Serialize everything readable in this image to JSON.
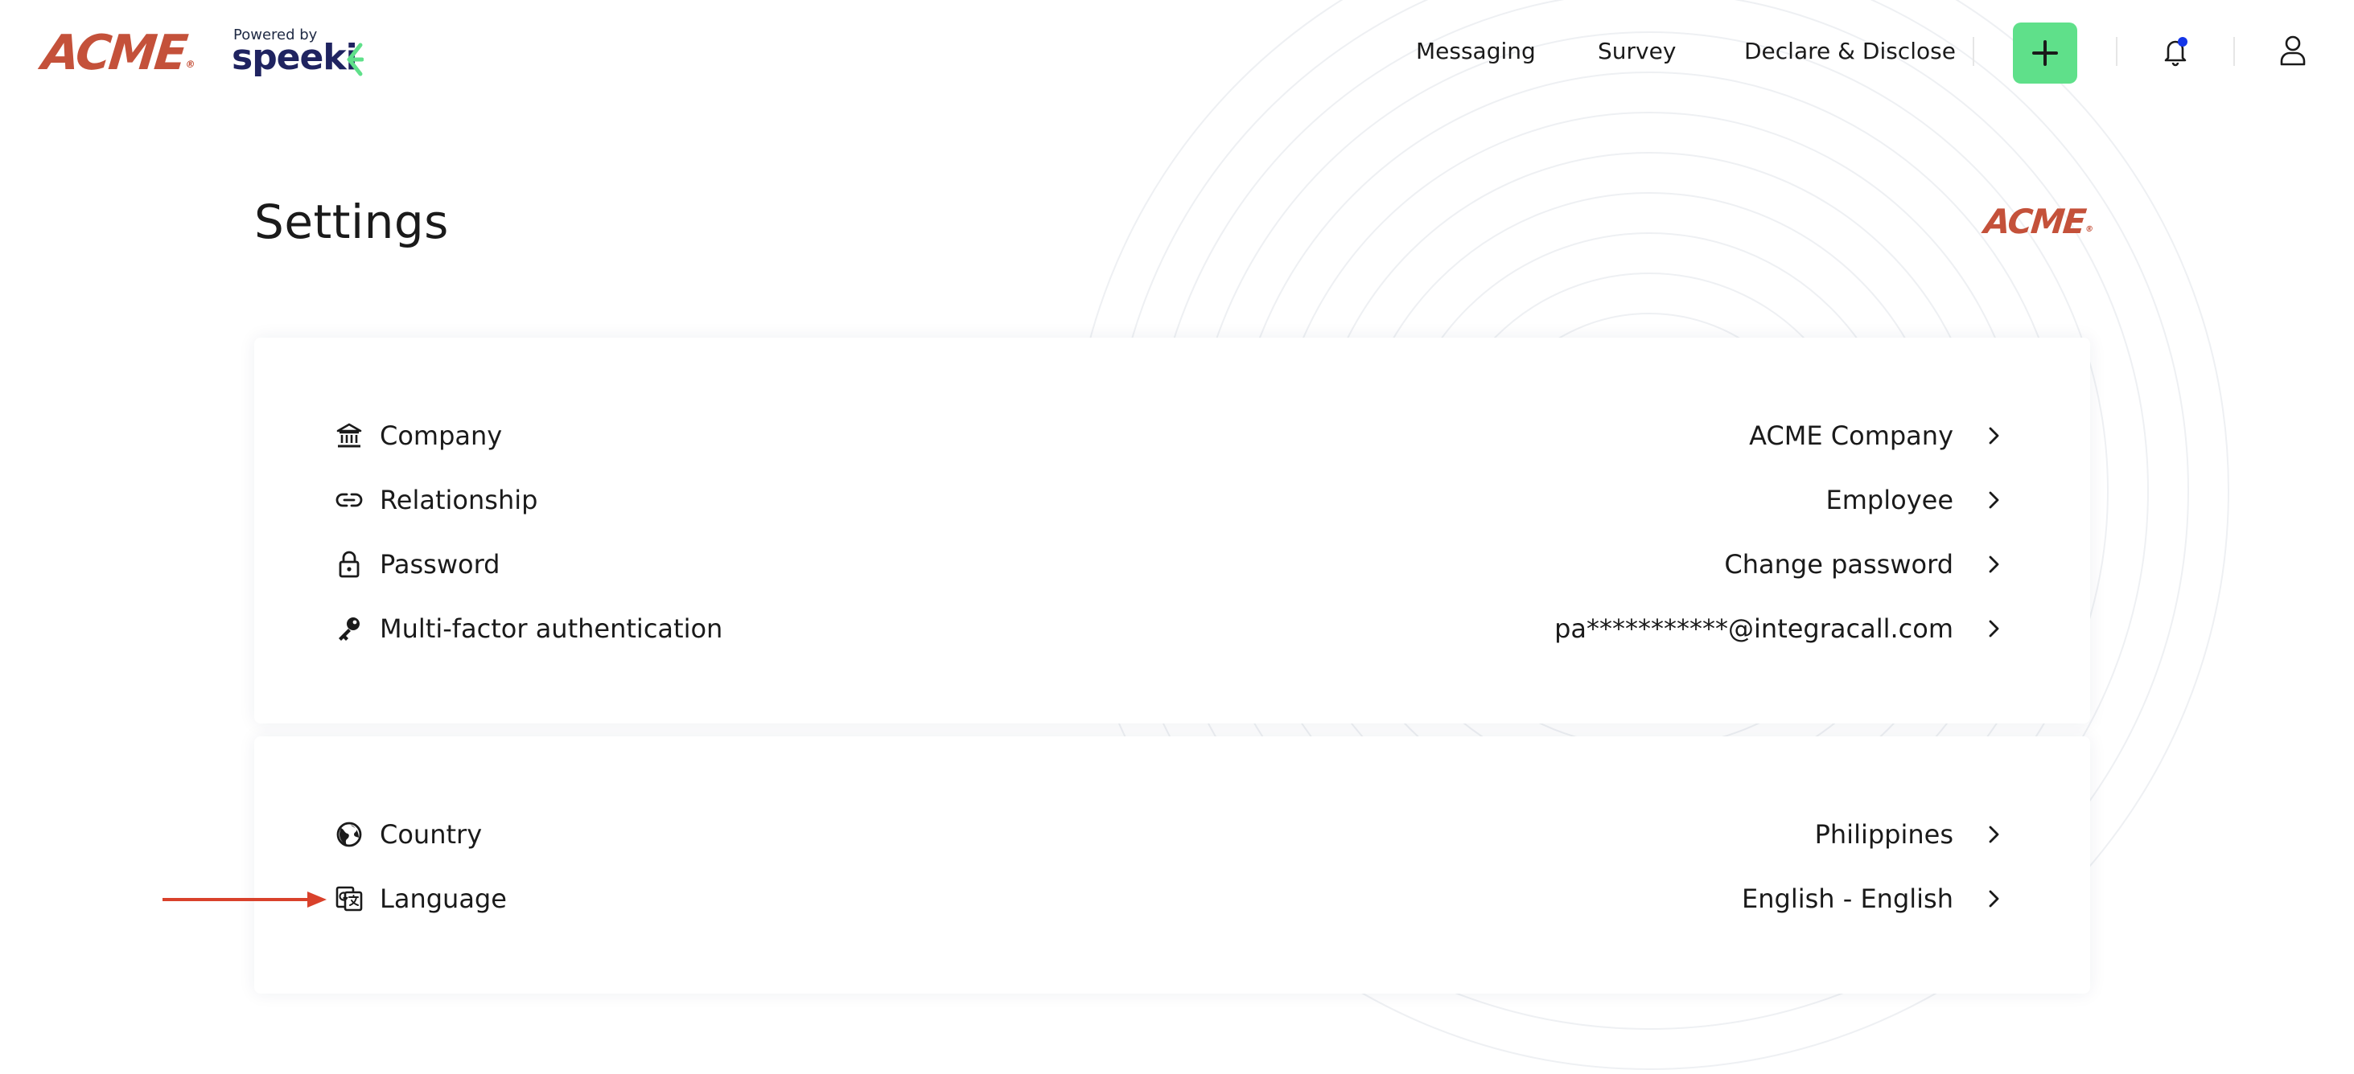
{
  "header": {
    "logo_text": "ACME",
    "logo_reg": "®",
    "powered_by": "Powered by",
    "partner_name": "speeki",
    "nav": [
      {
        "label": "Messaging"
      },
      {
        "label": "Survey"
      },
      {
        "label": "Declare & Disclose"
      }
    ],
    "add_icon": "plus-icon",
    "notification_icon": "bell-icon",
    "notification_badge_color": "#1536e8",
    "profile_icon": "user-icon"
  },
  "page": {
    "title": "Settings",
    "brand_logo_text": "ACME",
    "brand_logo_reg": "®"
  },
  "sections": [
    {
      "rows": [
        {
          "icon": "bank-icon",
          "label": "Company",
          "value": "ACME Company"
        },
        {
          "icon": "link-icon",
          "label": "Relationship",
          "value": "Employee"
        },
        {
          "icon": "lock-icon",
          "label": "Password",
          "value": "Change password"
        },
        {
          "icon": "key-icon",
          "label": "Multi-factor authentication",
          "value": "pa***********@integracall.com"
        }
      ]
    },
    {
      "rows": [
        {
          "icon": "globe-icon",
          "label": "Country",
          "value": "Philippines"
        },
        {
          "icon": "translate-icon",
          "label": "Language",
          "value": "English - English"
        }
      ]
    }
  ],
  "colors": {
    "brand_red": "#c4513a",
    "accent_green": "#5fe08a",
    "speeki_navy": "#1f2360",
    "annotation_red": "#d9412b"
  }
}
